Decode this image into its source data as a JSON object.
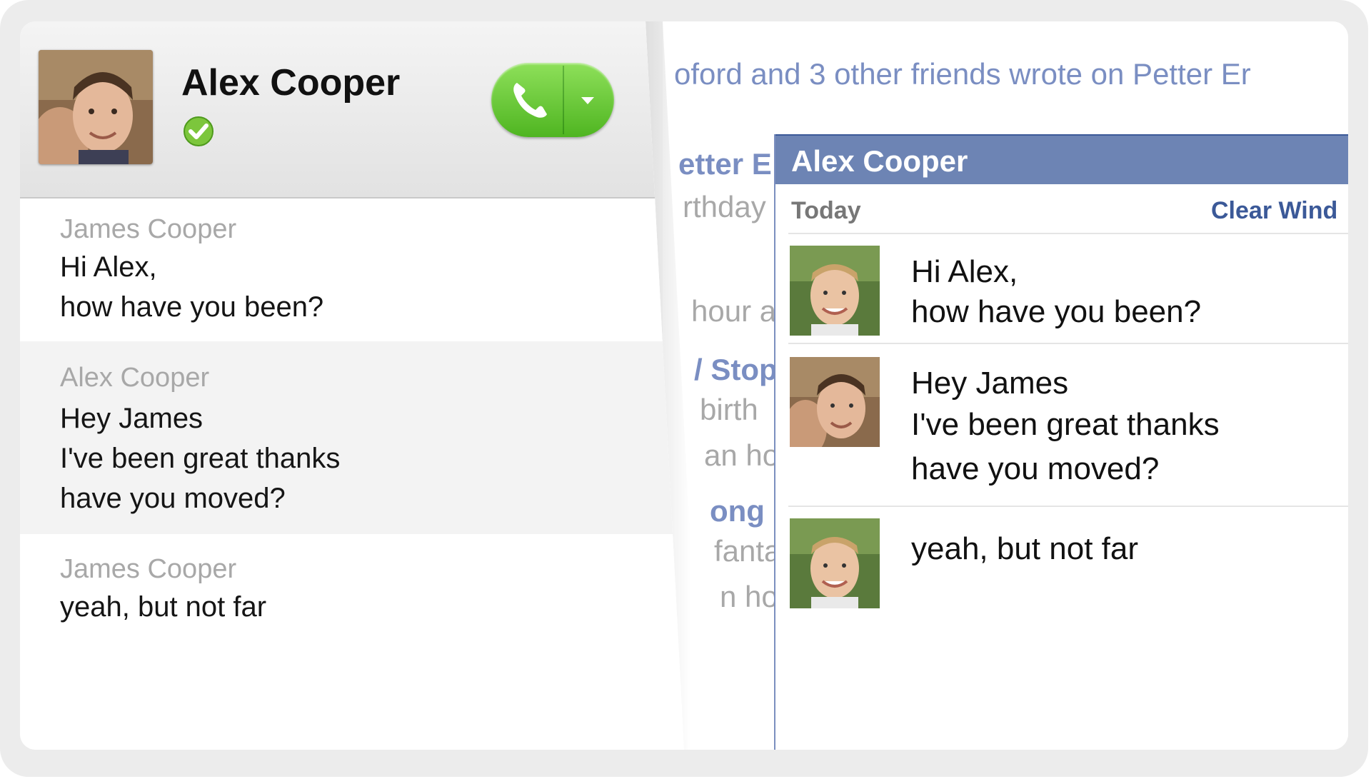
{
  "skype": {
    "contact_name": "Alex Cooper",
    "status": "online",
    "messages": [
      {
        "sender": "James Cooper",
        "lines": [
          "Hi Alex,",
          "how have you been?"
        ]
      },
      {
        "sender": "Alex Cooper",
        "lines": [
          "Hey James",
          "I've been great thanks",
          "have you moved?"
        ]
      },
      {
        "sender": "James Cooper",
        "lines": [
          "yeah, but not far"
        ]
      }
    ]
  },
  "facebook_bg": {
    "feed_line": "oford and 3 other friends wrote on Petter Er",
    "fragments": [
      "etter E",
      "rthday",
      "hour a",
      "/ Stop",
      "birth",
      "an ho",
      "ong",
      "fanta",
      "n ho"
    ]
  },
  "facebook_chat": {
    "title": "Alex Cooper",
    "date_label": "Today",
    "clear_label": "Clear Wind",
    "messages": [
      {
        "lines": [
          "Hi Alex,",
          "how have you been?"
        ]
      },
      {
        "lines": [
          "Hey James",
          "I've been great thanks",
          "have you moved?"
        ]
      },
      {
        "lines": [
          "yeah, but not far"
        ]
      }
    ]
  },
  "colors": {
    "call_green": "#5cc22c",
    "facebook_blue": "#6d84b4",
    "facebook_dark": "#3b5998"
  },
  "icons": [
    "phone-icon",
    "chevron-down-icon",
    "online-status-icon"
  ]
}
